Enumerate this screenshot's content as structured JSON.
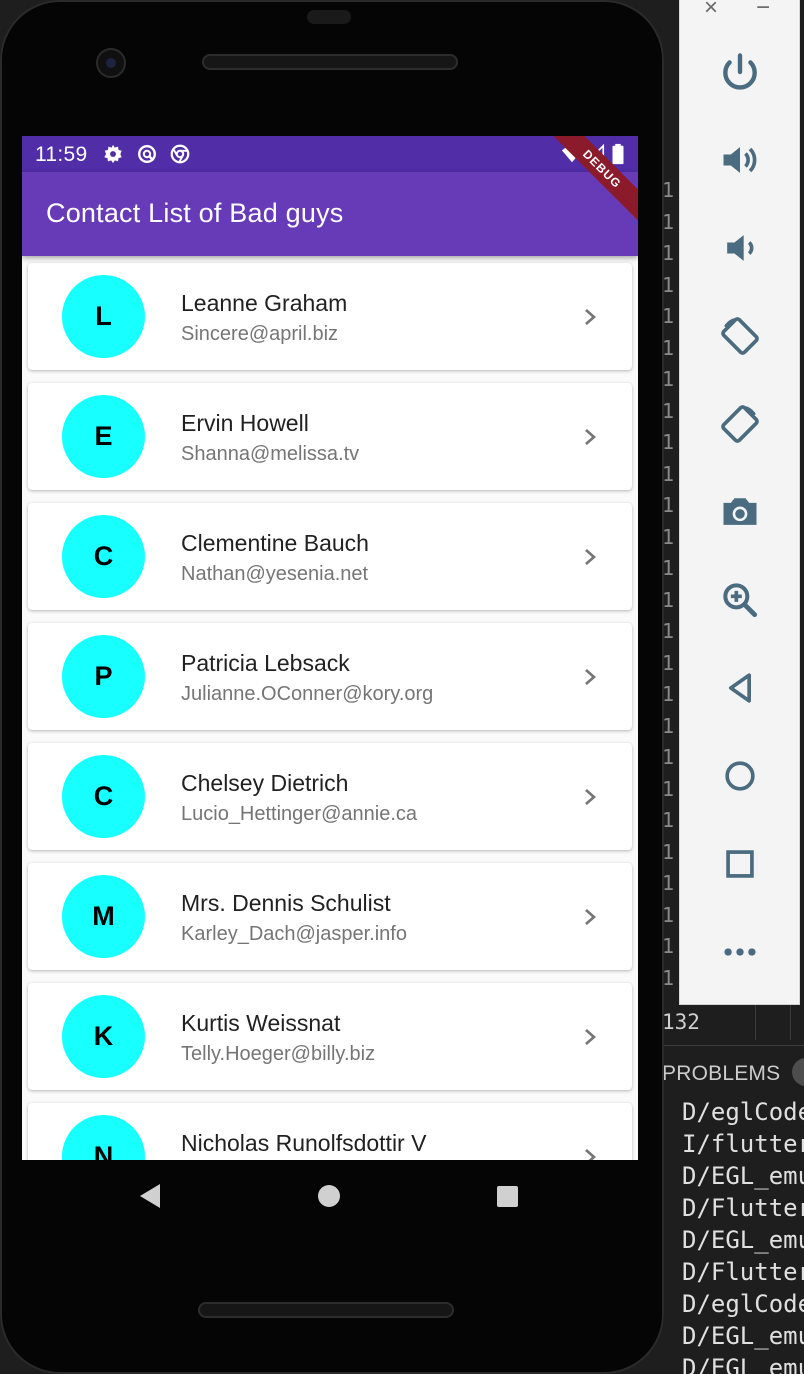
{
  "status_bar": {
    "time": "11:59"
  },
  "app_bar": {
    "title": "Contact List of Bad guys",
    "debug_label": "DEBUG"
  },
  "contacts": [
    {
      "initial": "L",
      "name": "Leanne Graham",
      "email": "Sincere@april.biz"
    },
    {
      "initial": "E",
      "name": "Ervin Howell",
      "email": "Shanna@melissa.tv"
    },
    {
      "initial": "C",
      "name": "Clementine Bauch",
      "email": "Nathan@yesenia.net"
    },
    {
      "initial": "P",
      "name": "Patricia Lebsack",
      "email": "Julianne.OConner@kory.org"
    },
    {
      "initial": "C",
      "name": "Chelsey Dietrich",
      "email": "Lucio_Hettinger@annie.ca"
    },
    {
      "initial": "M",
      "name": "Mrs. Dennis Schulist",
      "email": "Karley_Dach@jasper.info"
    },
    {
      "initial": "K",
      "name": "Kurtis Weissnat",
      "email": "Telly.Hoeger@billy.biz"
    },
    {
      "initial": "N",
      "name": "Nicholas Runolfsdottir V",
      "email": ""
    }
  ],
  "emulator_toolbar": {
    "close": "×",
    "minimize": "−",
    "buttons": [
      "power-icon",
      "volume-up-icon",
      "volume-down-icon",
      "rotate-left-icon",
      "rotate-right-icon",
      "camera-icon",
      "zoom-icon",
      "back-icon",
      "home-icon",
      "overview-icon",
      "more-icon"
    ]
  },
  "ide": {
    "gutter": [
      "1",
      "1",
      "1",
      "1",
      "1",
      "1",
      "1",
      "1",
      "1",
      "1",
      "1",
      "1",
      "1",
      "1",
      "1",
      "1",
      "1",
      "1",
      "1",
      "1",
      "1",
      "1",
      "1",
      "1",
      "1",
      "1"
    ],
    "gutter_last": "132",
    "problems_label": "PROBLEMS",
    "terminal_lines": [
      "D/eglCode",
      "I/flutter",
      "D/EGL_emu",
      "D/Flutter",
      "D/EGL_emu",
      "D/Flutter",
      "D/eglCode",
      "D/EGL_emu",
      "D/EGL_emu"
    ]
  },
  "colors": {
    "status_bar": "#512da8",
    "app_bar": "#673ab7",
    "avatar": "#18ffff",
    "debug_banner": "#8b1a2b"
  }
}
